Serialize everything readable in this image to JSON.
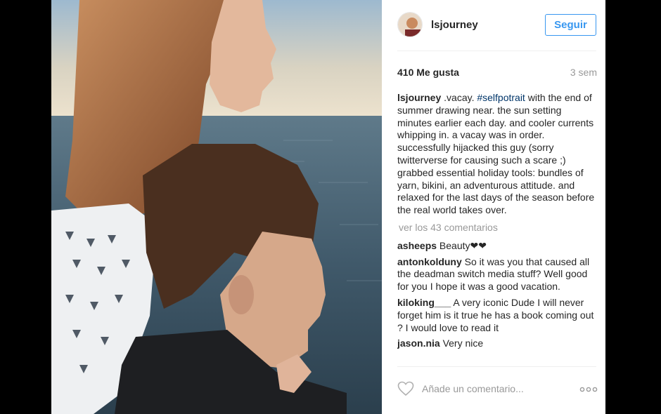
{
  "post": {
    "username": "lsjourney",
    "follow_label": "Seguir",
    "likes": "410 Me gusta",
    "age": "3 sem",
    "caption": {
      "user": "lsjourney",
      "text_before": " .vacay. ",
      "hashtag": "#selfpotrait",
      "text_after": " with the end of summer drawing near. the sun setting minutes earlier each day. and cooler currents whipping in. a vacay was in order. successfully hijacked this guy (sorry twitterverse for causing such a scare ;) grabbed essential holiday tools: bundles of yarn, bikini, an adventurous attitude. and relaxed for the last days of the season before the real world takes over."
    },
    "view_all_label": "ver los 43 comentarios",
    "comments": [
      {
        "user": "asheeps",
        "text": " Beauty❤❤"
      },
      {
        "user": "antonkolduny",
        "text": " So it was you that caused all the deadman switch media stuff? Well good for you I hope it was a good vacation."
      },
      {
        "user": "kiloking___",
        "text": " A very iconic Dude I will never forget him is it true he has a book coming out ? I would love to read it"
      },
      {
        "user": "jason.nia",
        "text": " Very nice"
      }
    ],
    "add_comment_placeholder": "Añade un comentario...",
    "more_label": "○○○"
  },
  "icons": {
    "heart": "heart-outline-icon",
    "more": "more-options-icon"
  },
  "colors": {
    "accent": "#3897f0",
    "muted": "#999999",
    "hashtag": "#003569"
  }
}
